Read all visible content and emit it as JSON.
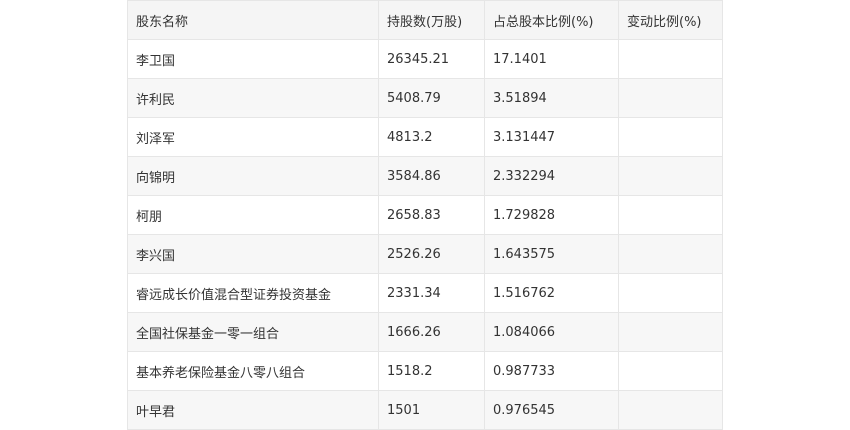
{
  "table": {
    "headers": [
      "股东名称",
      "持股数(万股)",
      "占总股本比例(%)",
      "变动比例(%)"
    ],
    "rows": [
      [
        "李卫国",
        "26345.21",
        "17.1401",
        ""
      ],
      [
        "许利民",
        "5408.79",
        "3.51894",
        ""
      ],
      [
        "刘泽军",
        "4813.2",
        "3.131447",
        ""
      ],
      [
        "向锦明",
        "3584.86",
        "2.332294",
        ""
      ],
      [
        "柯朋",
        "2658.83",
        "1.729828",
        ""
      ],
      [
        "李兴国",
        "2526.26",
        "1.643575",
        ""
      ],
      [
        "睿远成长价值混合型证券投资基金",
        "2331.34",
        "1.516762",
        ""
      ],
      [
        "全国社保基金一零一组合",
        "1666.26",
        "1.084066",
        ""
      ],
      [
        "基本养老保险基金八零八组合",
        "1518.2",
        "0.987733",
        ""
      ],
      [
        "叶早君",
        "1501",
        "0.976545",
        ""
      ]
    ]
  }
}
